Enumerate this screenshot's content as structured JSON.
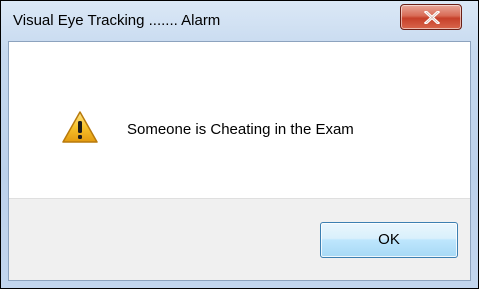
{
  "window": {
    "title": "Visual Eye Tracking ....... Alarm"
  },
  "titlebar": {
    "close_icon": "close-x-icon",
    "close_color": "#c6402a"
  },
  "message": {
    "icon": "warning-icon",
    "text": "Someone is Cheating in the Exam"
  },
  "buttons": {
    "ok_label": "OK"
  },
  "colors": {
    "titlebar": "#c6d9ef",
    "button_area": "#f0f0f0",
    "warning_yellow": "#f6c22b"
  }
}
